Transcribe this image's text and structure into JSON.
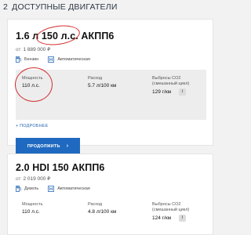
{
  "section": {
    "number": "2",
    "title": "ДОСТУПНЫЕ ДВИГАТЕЛИ"
  },
  "colors": {
    "accent": "#1f6ac0",
    "highlight": "#d32f2f",
    "link": "#2a6ab4"
  },
  "cards": [
    {
      "title": "1.6 л 150 л.с. АКПП6",
      "price_prefix": "от",
      "price": "1 889 000 ₽",
      "fuel": {
        "icon": "fuel-pump-icon",
        "label": "Бензин"
      },
      "transmission": {
        "icon": "gearbox-icon",
        "label": "Автоматическая"
      },
      "specs": {
        "power_label": "Мощность",
        "power_value": "110 л.с.",
        "consumption_label": "Расход",
        "consumption_value": "5.7 л/100 км",
        "co2_label": "Выбросы CO2 (смешанный цикл)",
        "co2_value": "129 г/км"
      },
      "more_label": "+ ПОДРОБНЕЕ",
      "continue_label": "ПРОДОЛЖИТЬ"
    },
    {
      "title": "2.0 HDI 150 АКПП6",
      "price_prefix": "от",
      "price": "2 019 000 ₽",
      "fuel": {
        "icon": "fuel-pump-icon",
        "label": "Дизель"
      },
      "transmission": {
        "icon": "gearbox-icon",
        "label": "Автоматическая"
      },
      "specs": {
        "power_label": "Мощность",
        "power_value": "110 л.с.",
        "consumption_label": "Расход",
        "consumption_value": "4.8 л/100 км",
        "co2_label": "Выбросы CO2 (смешанный цикл)",
        "co2_value": "124 г/км"
      }
    }
  ]
}
